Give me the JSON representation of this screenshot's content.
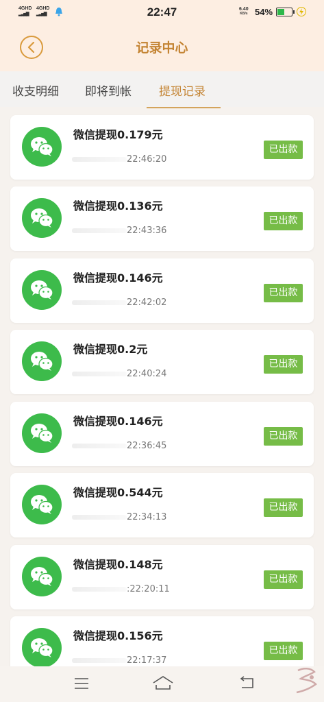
{
  "status_bar": {
    "sim1": "4GHD",
    "sim2": "4GHD",
    "time": "22:47",
    "net_speed_value": "6.40",
    "net_speed_unit": "KB/s",
    "battery_percent": "54%",
    "battery_level": 0.54
  },
  "header": {
    "title": "记录中心",
    "back_icon": "chevron-left-icon"
  },
  "tabs": [
    {
      "label": "收支明细",
      "active": false
    },
    {
      "label": "即将到帐",
      "active": false
    },
    {
      "label": "提现记录",
      "active": true
    }
  ],
  "records": [
    {
      "title": "微信提现0.179元",
      "time": "22:46:20",
      "status": "已出款",
      "icon": "wechat-icon"
    },
    {
      "title": "微信提现0.136元",
      "time": "22:43:36",
      "status": "已出款",
      "icon": "wechat-icon"
    },
    {
      "title": "微信提现0.146元",
      "time": "22:42:02",
      "status": "已出款",
      "icon": "wechat-icon"
    },
    {
      "title": "微信提现0.2元",
      "time": "22:40:24",
      "status": "已出款",
      "icon": "wechat-icon"
    },
    {
      "title": "微信提现0.146元",
      "time": "22:36:45",
      "status": "已出款",
      "icon": "wechat-icon"
    },
    {
      "title": "微信提现0.544元",
      "time": "22:34:13",
      "status": "已出款",
      "icon": "wechat-icon"
    },
    {
      "title": "微信提现0.148元",
      "time": ":22:20:11",
      "status": "已出款",
      "icon": "wechat-icon"
    },
    {
      "title": "微信提现0.156元",
      "time": "22:17:37",
      "status": "已出款",
      "icon": "wechat-icon"
    }
  ],
  "colors": {
    "accent": "#c48433",
    "status_green": "#76bc47",
    "wechat_green": "#3dbb4b"
  }
}
